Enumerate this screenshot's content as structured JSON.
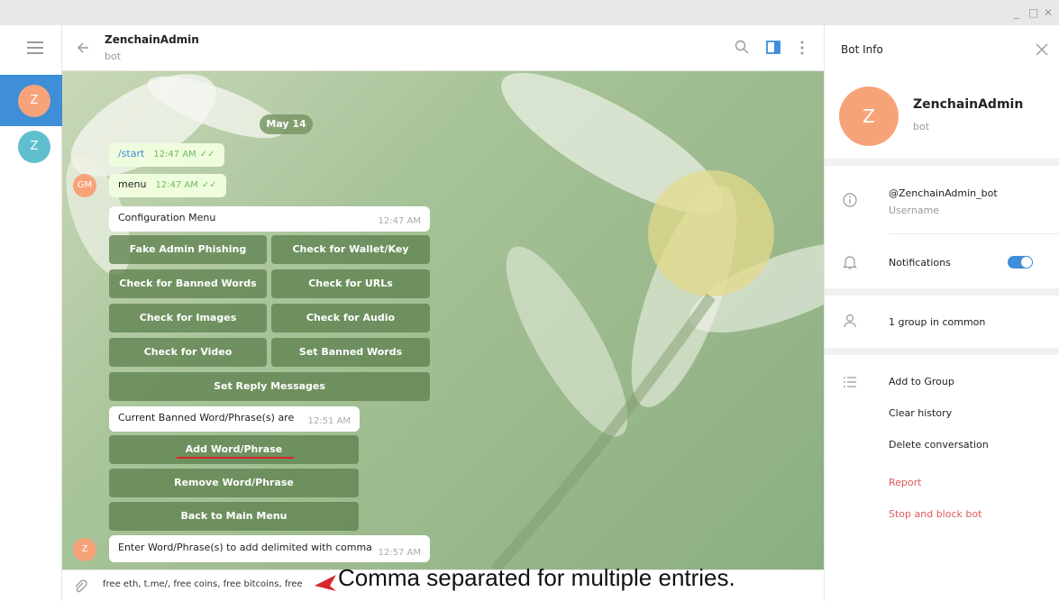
{
  "window": {
    "min": "_",
    "max": "□",
    "close": "✕"
  },
  "sidebar": {
    "chats": [
      {
        "initial": "Z"
      },
      {
        "initial": "Z"
      }
    ]
  },
  "header": {
    "title": "ZenchainAdmin",
    "subtitle": "bot"
  },
  "chat": {
    "date": "May 14",
    "messages": [
      {
        "text": "/start",
        "time": "12:47 AM",
        "check": "✓✓"
      },
      {
        "text": "menu",
        "time": "12:47 AM",
        "check": "✓✓",
        "avatar": "GM"
      },
      {
        "text": "Configuration Menu",
        "time": "12:47 AM"
      },
      {
        "text": "Current Banned Word/Phrase(s) are",
        "time": "12:51 AM"
      },
      {
        "text": "Enter Word/Phrase(s) to add delimited with comma",
        "time": "12:57 AM",
        "avatar": "Z"
      }
    ],
    "keyboard1": [
      "Fake Admin Phishing",
      "Check for Wallet/Key",
      "Check for Banned Words",
      "Check for URLs",
      "Check for Images",
      "Check for Audio",
      "Check for Video",
      "Set Banned Words",
      "Set Reply Messages"
    ],
    "keyboard2": [
      "Add Word/Phrase",
      "Remove Word/Phrase",
      "Back to Main Menu"
    ]
  },
  "composer": {
    "text": "free eth, t.me/, free coins, free bitcoins, free"
  },
  "annotation": {
    "text": "Comma separated for multiple entries.",
    "color": "#d7262c"
  },
  "bot_info": {
    "title": "Bot Info",
    "name": "ZenchainAdmin",
    "sub": "bot",
    "initial": "Z",
    "username": "@ZenchainAdmin_bot",
    "username_label": "Username",
    "notifications": "Notifications",
    "notifications_on": true,
    "groups": "1 group in common",
    "actions": [
      "Add to Group",
      "Clear history",
      "Delete conversation"
    ],
    "danger": [
      "Report",
      "Stop and block bot"
    ]
  },
  "colors": {
    "accent": "#3e8ed8",
    "danger": "#e05a5a",
    "avatar_orange": "#f7a37a",
    "avatar_teal": "#5fbfcf"
  }
}
